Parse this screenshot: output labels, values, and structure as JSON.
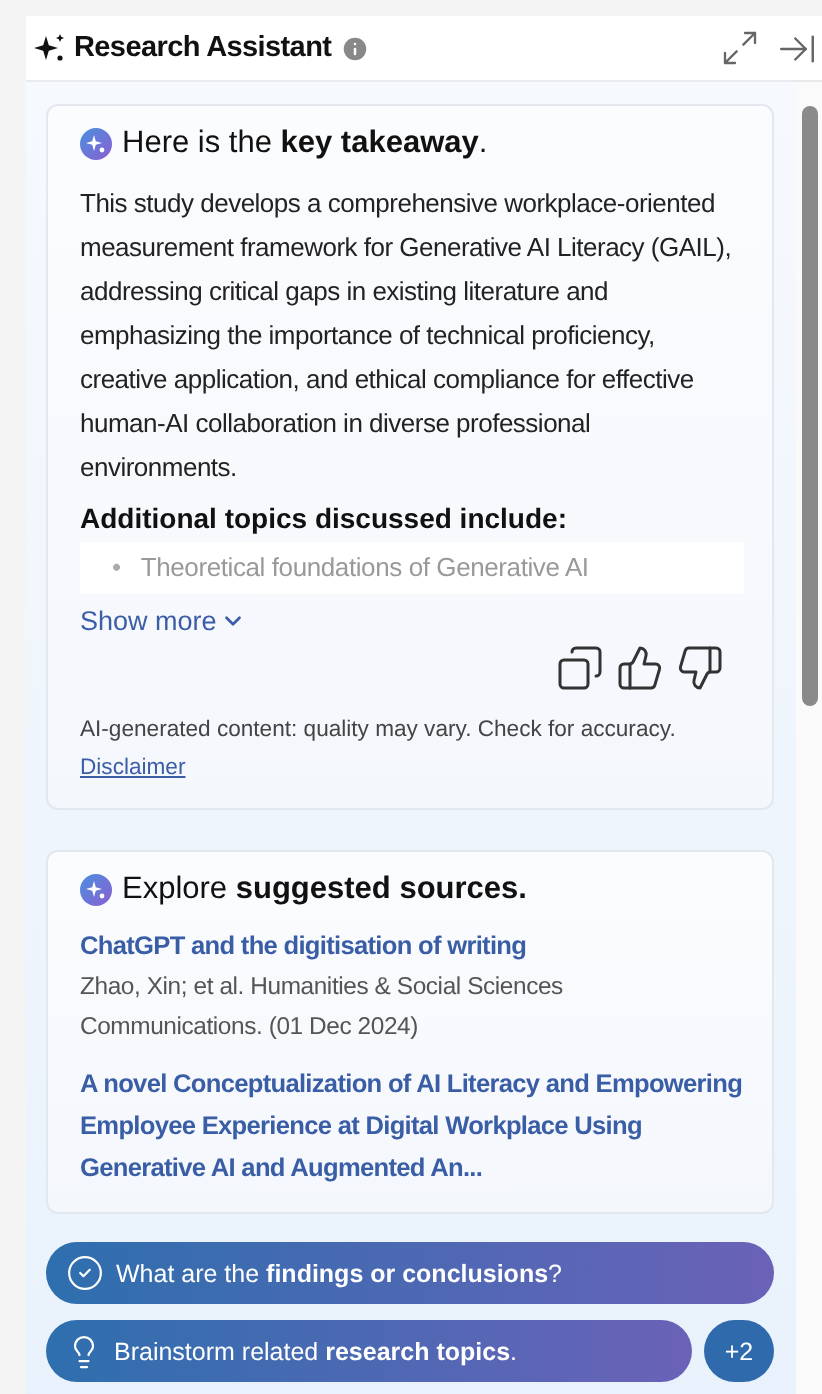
{
  "header": {
    "title": "Research Assistant"
  },
  "takeaway": {
    "heading": "Here is the **key takeaway**.",
    "summary": "This study develops a comprehensive workplace-oriented measurement framework for Generative AI Literacy (GAIL), addressing critical gaps in existing literature and emphasizing the importance of technical proficiency, creative application, and ethical compliance for effective human-AI collaboration in diverse professional environments.",
    "topics_heading": "Additional topics discussed include:",
    "topics": [
      {
        "marker": "•",
        "text": "Theoretical foundations of Generative AI"
      }
    ],
    "show_more": "Show more",
    "disclaimer_note": "AI-generated content: quality may vary. Check for accuracy.",
    "disclaimer_link": "Disclaimer"
  },
  "sources": {
    "heading": "Explore **suggested sources.**",
    "items": [
      {
        "title": "ChatGPT and the digitisation of writing",
        "meta": "Zhao, Xin; et al.  Humanities & Social Sciences Communications. (01 Dec 2024)"
      },
      {
        "title": "A novel Conceptualization of AI Literacy and Empowering Employee Experience at Digital Workplace Using Generative AI and Augmented An..."
      }
    ]
  },
  "prompts": [
    {
      "kind": "check",
      "text": "What are the **findings or conclusions**?"
    },
    {
      "kind": "bulb",
      "text": "Brainstorm related **research topics**."
    }
  ],
  "more_count": "+2"
}
